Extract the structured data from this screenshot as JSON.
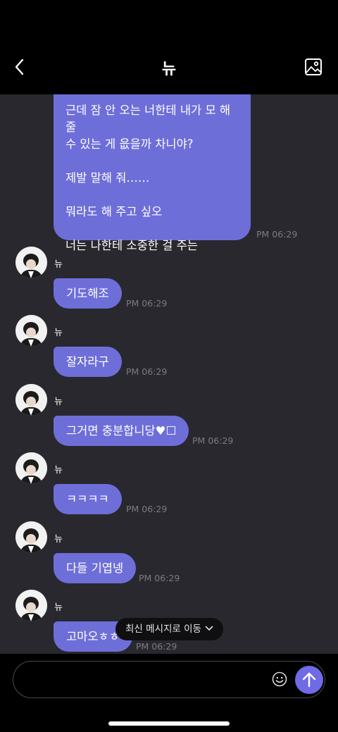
{
  "header": {
    "title": "뉴",
    "back_icon": "chevron-left-icon",
    "gallery_icon": "image-icon"
  },
  "first_message": {
    "paragraphs": [
      "근데 잠 안 오는 너한테 내가 모 해 줄\n수 있는 게 읎을까 차니야?",
      "제발 말해 줘……",
      "뭐라도 해 주고 싶오",
      "너는 나한테 소중한 걸 주는"
    ],
    "time": "PM 06:29"
  },
  "messages": [
    {
      "sender": "뉴",
      "text": "기도해조",
      "time": "PM 06:29"
    },
    {
      "sender": "뉴",
      "text": "잘자라구",
      "time": "PM 06:29"
    },
    {
      "sender": "뉴",
      "text": "그거면 충분합니당♥︎☐",
      "time": "PM 06:29"
    },
    {
      "sender": "뉴",
      "text": "ㅋㅋㅋㅋ",
      "time": "PM 06:29"
    },
    {
      "sender": "뉴",
      "text": "다들 기엽넹",
      "time": "PM 06:29"
    },
    {
      "sender": "뉴",
      "text": "고마오ㅎㅎ",
      "time": "PM 06:29"
    }
  ],
  "toast": {
    "label": "최신 메시지로 이동",
    "icon": "chevron-down-icon"
  },
  "composer": {
    "value": "",
    "emoji_icon": "smiley-icon",
    "send_icon": "arrow-up-icon"
  },
  "colors": {
    "bubble": "#6e6ed9",
    "chat_bg": "#29282e",
    "header_bg": "#000000",
    "send": "#6f6be6"
  }
}
